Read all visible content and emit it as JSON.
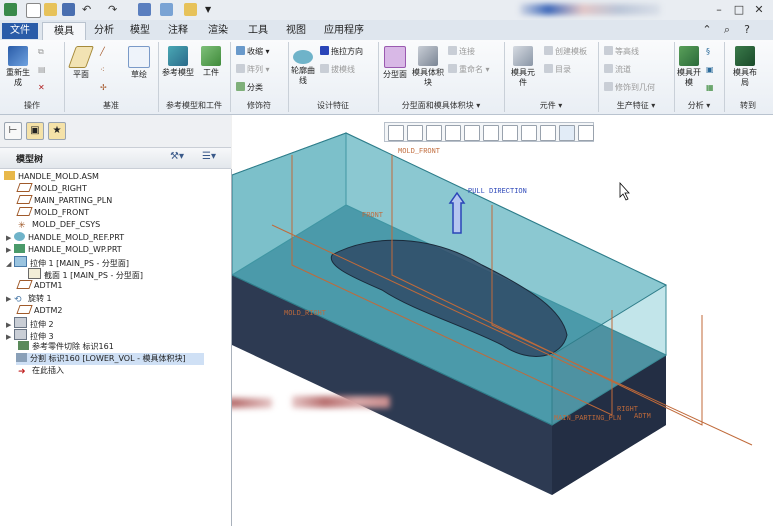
{
  "menu": {
    "file": "文件",
    "tabs": [
      "模具",
      "分析",
      "模型",
      "注释",
      "渲染",
      "工具",
      "视图",
      "应用程序"
    ]
  },
  "ribbon": {
    "groups": [
      "操作",
      "基准",
      "参考模型和工件",
      "修饰符",
      "设计特征",
      "分型面和模具体积块",
      "元件",
      "生产特征",
      "分析",
      "转到"
    ],
    "regen": "重新生成",
    "plane": "平面",
    "sketch": "草绘",
    "ref_model": "参考模型",
    "workpiece": "工件",
    "shrink": "收缩",
    "array": "阵列",
    "classify": "分类",
    "contour": "轮廓曲线",
    "pull_dir": "拖拉方向",
    "drag_line": "拔模线",
    "parting_face": "分型面",
    "mold_volume": "模具体积块",
    "connect": "连接",
    "rename": "重命名",
    "mold_comp": "模具元件",
    "create_template": "创建模板",
    "catalog": "目录",
    "contour_line": "等高线",
    "runner": "流道",
    "modify_geo": "修饰到几何",
    "mold_open": "模具开模",
    "mold_layout": "模具布局"
  },
  "tree": {
    "header": "模型树",
    "items": [
      "HANDLE_MOLD.ASM",
      "MOLD_RIGHT",
      "MAIN_PARTING_PLN",
      "MOLD_FRONT",
      "MOLD_DEF_CSYS",
      "HANDLE_MOLD_REF.PRT",
      "HANDLE_MOLD_WP.PRT",
      "拉伸 1 [MAIN_PS - 分型面]",
      "截面 1 [MAIN_PS - 分型面]",
      "ADTM1",
      "旋转 1",
      "ADTM2",
      "拉伸 2",
      "拉伸 3",
      "参考零件切除 标识161",
      "分割 标识160 [LOWER_VOL - 模具体积块]",
      "在此插入"
    ]
  },
  "viewport": {
    "labels": {
      "mold_front": "MOLD_FRONT",
      "pull_direction": "PULL DIRECTION",
      "front": "FRONT",
      "mold_right": "MOLD_RIGHT",
      "right": "RIGHT",
      "main_parting": "MAIN_PARTING_PLN",
      "adtm": "ADTM"
    }
  },
  "colors": {
    "accent": "#2a5ca8",
    "upper_block": "#5ab0bd",
    "lower_block": "#2d3a52",
    "datum": "#c06a3a",
    "pull_arrow": "#2a45b8"
  }
}
